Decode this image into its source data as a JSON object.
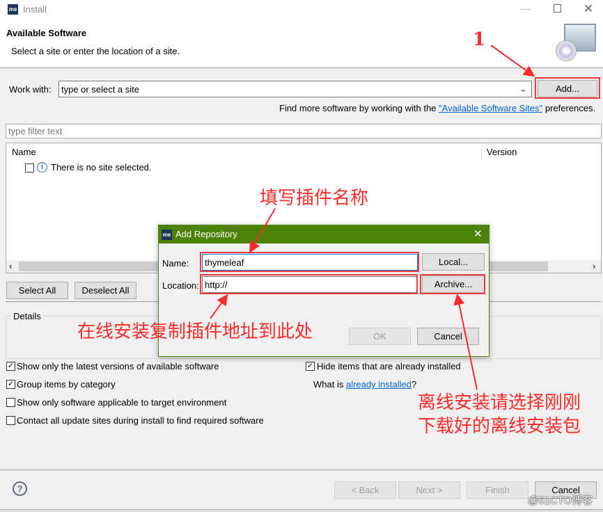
{
  "window": {
    "title": "Install",
    "logo": "me"
  },
  "header": {
    "title": "Available Software",
    "subtitle": "Select a site or enter the location of a site."
  },
  "work_with": {
    "label": "Work with:",
    "value": "type or select a site",
    "add_button": "Add..."
  },
  "find_more": {
    "prefix": "Find more software by working with the ",
    "link": "\"Available Software Sites\"",
    "suffix": " preferences."
  },
  "filter": {
    "placeholder": "type filter text"
  },
  "table": {
    "columns": [
      "Name",
      "Version"
    ],
    "empty_message": "There is no site selected."
  },
  "buttons": {
    "select_all": "Select All",
    "deselect_all": "Deselect All"
  },
  "details": {
    "label": "Details"
  },
  "options": [
    {
      "label": "Show only the latest versions of available software",
      "checked": true
    },
    {
      "label": "Group items by category",
      "checked": true
    },
    {
      "label": "Show only software applicable to target environment",
      "checked": false
    },
    {
      "label": "Contact all update sites during install to find required software",
      "checked": false
    },
    {
      "label": "Hide items that are already installed",
      "checked": true
    }
  ],
  "what_is": {
    "prefix": "What is ",
    "link": "already installed",
    "suffix": "?"
  },
  "footer": {
    "back": "< Back",
    "next": "Next >",
    "finish": "Finish",
    "cancel": "Cancel"
  },
  "dialog": {
    "title": "Add Repository",
    "logo": "me",
    "name_label": "Name:",
    "name_value": "thymeleaf",
    "location_label": "Location:",
    "location_value": "http://",
    "local_button": "Local...",
    "archive_button": "Archive...",
    "ok": "OK",
    "cancel": "Cancel",
    "title_color": "#4b8207"
  },
  "annotations": {
    "step": "1",
    "name_note": "填写插件名称",
    "location_note": "在线安装复制插件地址到此处",
    "archive_note_1": "离线安装请选择刚刚",
    "archive_note_2": "下载好的离线安装包",
    "color": "#ff2a2a"
  },
  "watermark": "@51CTO博客"
}
